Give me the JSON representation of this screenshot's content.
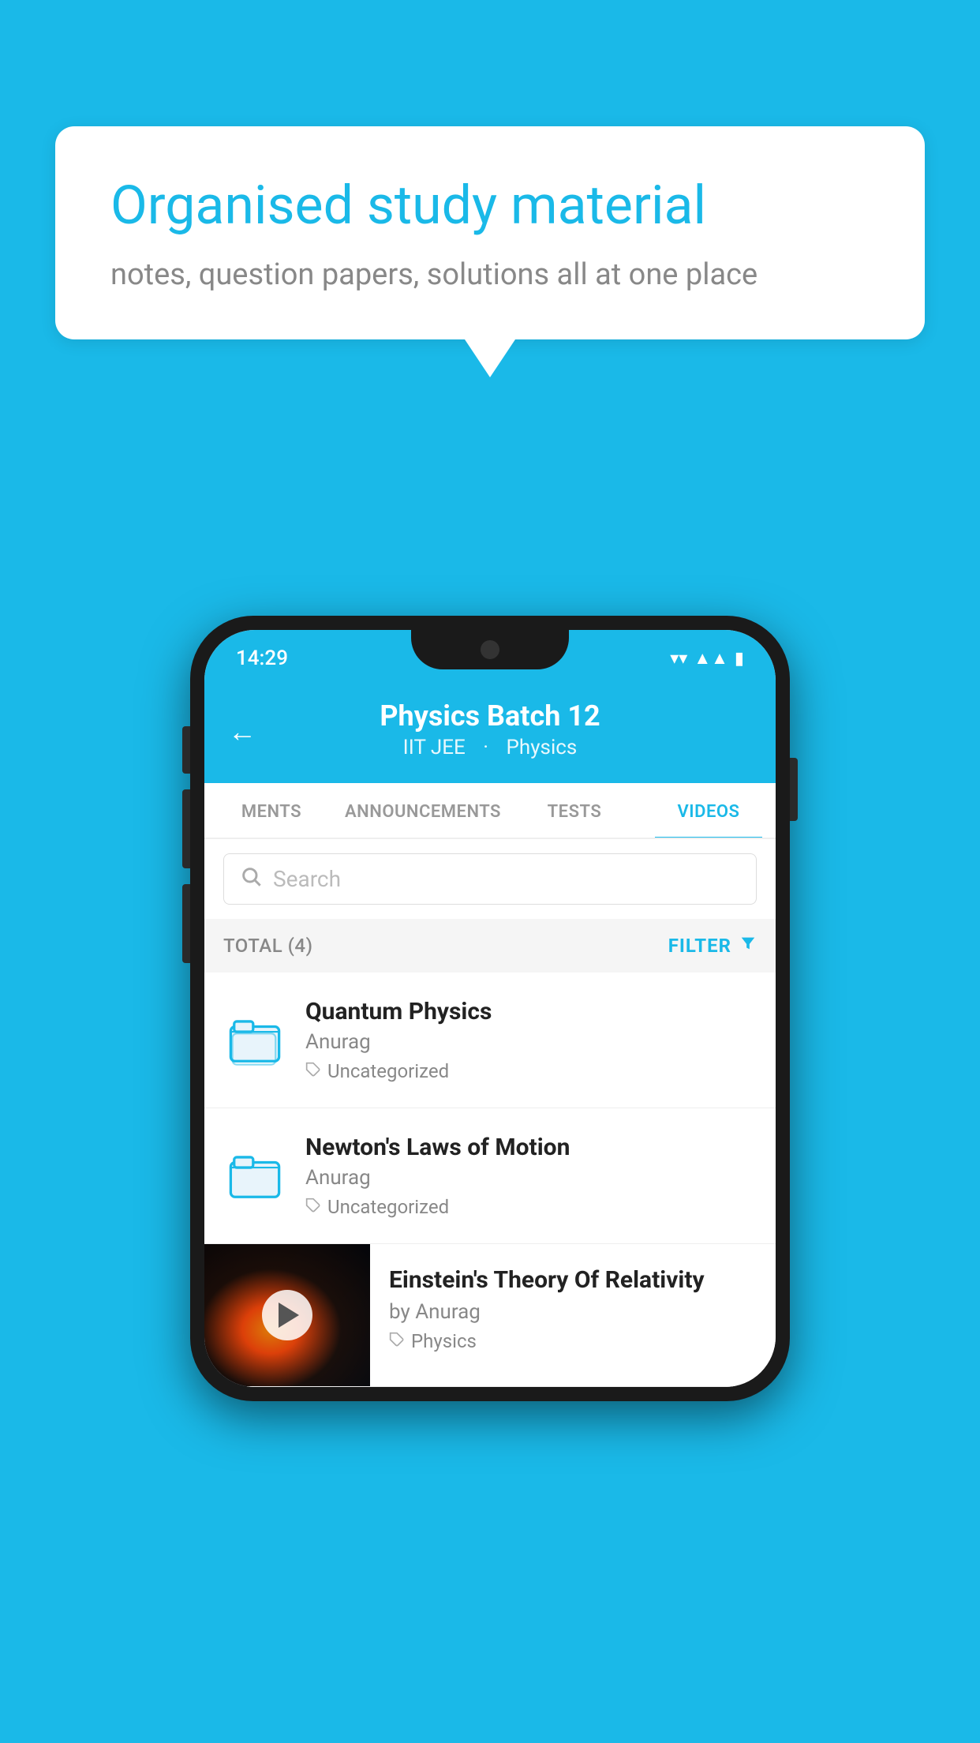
{
  "page": {
    "background_color": "#1ab9e8"
  },
  "speech_bubble": {
    "title": "Organised study material",
    "subtitle": "notes, question papers, solutions all at one place"
  },
  "status_bar": {
    "time": "14:29",
    "wifi": "▼",
    "signal": "▲",
    "battery": "▮"
  },
  "app_header": {
    "back_label": "←",
    "title": "Physics Batch 12",
    "subtitle_part1": "IIT JEE",
    "subtitle_part2": "Physics"
  },
  "tabs": [
    {
      "label": "MENTS",
      "active": false
    },
    {
      "label": "ANNOUNCEMENTS",
      "active": false
    },
    {
      "label": "TESTS",
      "active": false
    },
    {
      "label": "VIDEOS",
      "active": true
    }
  ],
  "search": {
    "placeholder": "Search"
  },
  "filter_bar": {
    "total_label": "TOTAL (4)",
    "filter_label": "FILTER"
  },
  "video_list": [
    {
      "id": 1,
      "title": "Quantum Physics",
      "author": "Anurag",
      "tag": "Uncategorized",
      "has_thumb": false
    },
    {
      "id": 2,
      "title": "Newton's Laws of Motion",
      "author": "Anurag",
      "tag": "Uncategorized",
      "has_thumb": false
    },
    {
      "id": 3,
      "title": "Einstein's Theory Of Relativity",
      "author": "by Anurag",
      "tag": "Physics",
      "has_thumb": true
    }
  ]
}
